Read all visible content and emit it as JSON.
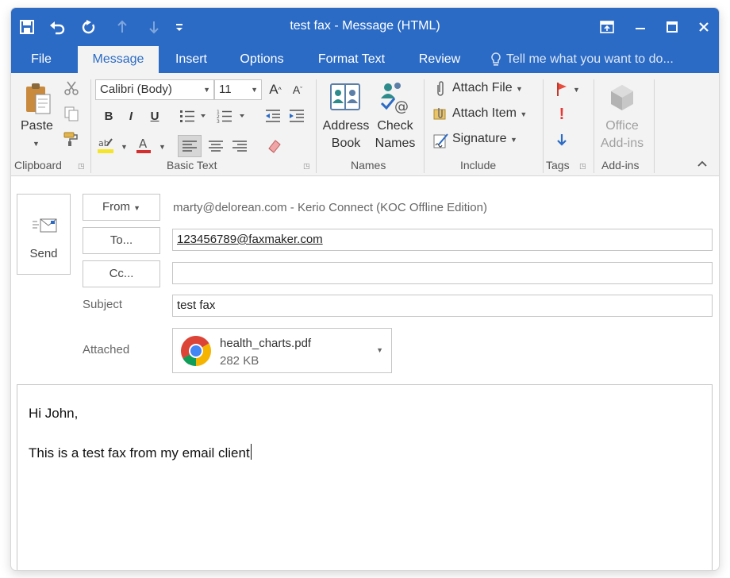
{
  "window": {
    "title": "test fax - Message (HTML)"
  },
  "tabs": [
    {
      "label": "File"
    },
    {
      "label": "Message"
    },
    {
      "label": "Insert"
    },
    {
      "label": "Options"
    },
    {
      "label": "Format Text"
    },
    {
      "label": "Review"
    }
  ],
  "tell_me": {
    "placeholder": "Tell me what you want to do..."
  },
  "ribbon": {
    "clipboard": {
      "label": "Clipboard",
      "paste_label": "Paste"
    },
    "basic_text": {
      "label": "Basic Text",
      "font_name": "Calibri (Body)",
      "font_size": "11",
      "bold": "B",
      "italic": "I",
      "underline": "U"
    },
    "names": {
      "label": "Names",
      "address_book_line1": "Address",
      "address_book_line2": "Book",
      "check_names_line1": "Check",
      "check_names_line2": "Names"
    },
    "include": {
      "label": "Include",
      "attach_file": "Attach File",
      "attach_item": "Attach Item",
      "signature": "Signature"
    },
    "tags": {
      "label": "Tags"
    },
    "addins": {
      "label": "Add-ins",
      "office_addins_line1": "Office",
      "office_addins_line2": "Add-ins"
    }
  },
  "compose": {
    "send_label": "Send",
    "from_label": "From",
    "from_value": "marty@delorean.com - Kerio Connect (KOC Offline Edition)",
    "to_label": "To...",
    "to_value": "123456789@faxmaker.com",
    "cc_label": "Cc...",
    "cc_value": "",
    "subject_label": "Subject",
    "subject_value": "test fax",
    "attached_label": "Attached",
    "attachment": {
      "name": "health_charts.pdf",
      "size": "282 KB"
    }
  },
  "message_body": {
    "greeting": "Hi John,",
    "text": "This is a test fax from my email client"
  },
  "colors": {
    "accent": "#2b6bc5",
    "highlight_yellow": "#f5e52a",
    "font_color_red": "#d32f2f"
  }
}
